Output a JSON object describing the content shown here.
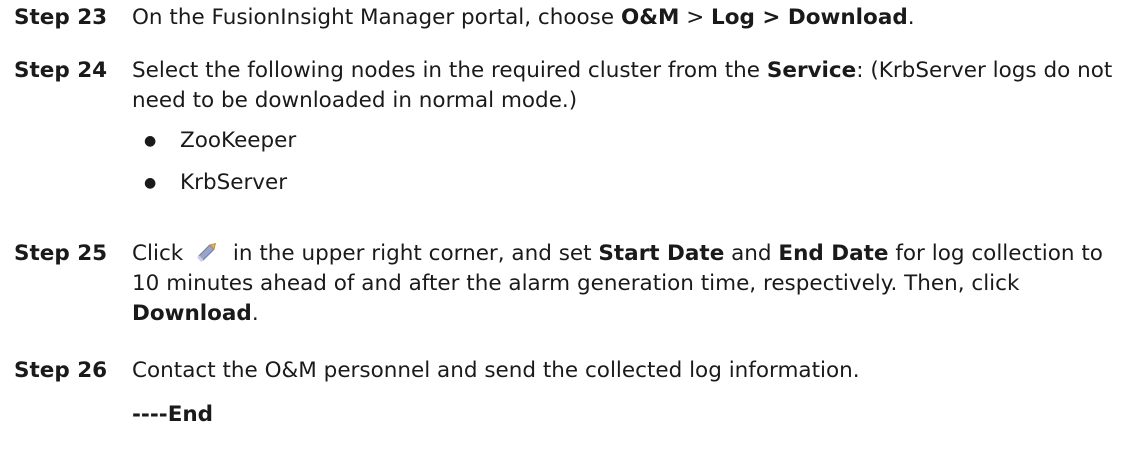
{
  "steps": [
    {
      "label": "Step 23",
      "text_1": "On the FusionInsight Manager portal, choose ",
      "bold_1": "O&M",
      "text_2": " > ",
      "bold_2": "Log > Download",
      "text_3": "."
    },
    {
      "label": "Step 24",
      "text_1": "Select the following nodes in the required cluster from the ",
      "bold_1": "Service",
      "text_2": ": (KrbServer logs do not need to be downloaded in normal mode.)",
      "bullets": [
        "ZooKeeper",
        "KrbServer"
      ]
    },
    {
      "label": "Step 25",
      "text_1": "Click ",
      "icon": "pencil-edit-icon",
      "text_2": " in the upper right corner, and set ",
      "bold_1": "Start Date",
      "text_3": " and ",
      "bold_2": "End Date",
      "text_4": " for log collection to 10 minutes ahead of and after the alarm generation time, respectively. Then, click ",
      "bold_3": "Download",
      "text_5": "."
    },
    {
      "label": "Step 26",
      "text_1": "Contact the O&M personnel and send the collected log information."
    }
  ],
  "end_marker": "----End",
  "bullet_char": "●",
  "colors": {
    "text": "#1a1a1a",
    "icon_body": "#9aa4c8",
    "icon_tip": "#e0b464"
  }
}
